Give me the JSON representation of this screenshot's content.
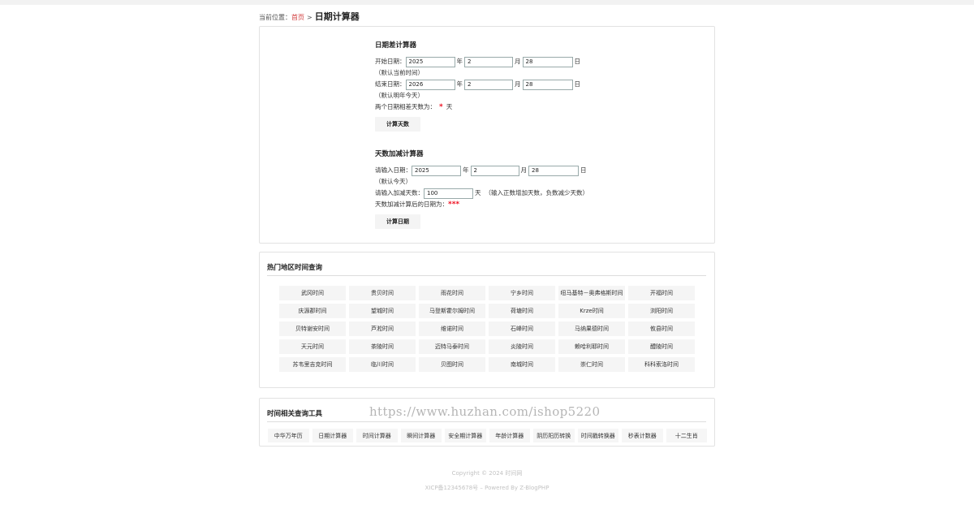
{
  "breadcrumb": {
    "prefix": "当前位置：",
    "home": "首页",
    "sep": ">",
    "current": "日期计算器"
  },
  "diff_calc": {
    "title": "日期差计算器",
    "start_label": "开始日期：",
    "start_year": "2025",
    "start_month": "2",
    "start_day": "28",
    "start_note": "（默认当前时间）",
    "end_label": "结束日期：",
    "end_year": "2026",
    "end_month": "2",
    "end_day": "28",
    "end_note": "（默认明年今天）",
    "result_label": "两个日期相差天数为：",
    "result_value": "*",
    "result_unit": "天",
    "button": "计算天数"
  },
  "add_calc": {
    "title": "天数加减计算器",
    "date_label": "请输入日期：",
    "year": "2025",
    "month": "2",
    "day": "28",
    "date_note": "（默认今天）",
    "days_label": "请输入加减天数：",
    "days_value": "100",
    "days_unit": "天",
    "days_note": "（输入正数增加天数，负数减少天数）",
    "result_label": "天数加减计算后的日期为：",
    "result_value": "***",
    "button": "计算日期"
  },
  "units": {
    "year": "年",
    "month": "月",
    "day": "日"
  },
  "regions": {
    "title": "热门地区时间查询",
    "items": [
      "武冈时间",
      "贵贝时间",
      "雨花时间",
      "宁乡时间",
      "纽马基特－奥弗格斯时间",
      "开福时间",
      "庆源郡时间",
      "望城时间",
      "马登斯霍尔姆时间",
      "荷塘时间",
      "Krze时间",
      "浏阳时间",
      "贝特谢安时间",
      "芦淞时间",
      "维诺时间",
      "石峰时间",
      "马纳果德时间",
      "攸县时间",
      "天元时间",
      "茶陵时间",
      "迈特马泰时间",
      "炎陵时间",
      "赖哈利耶时间",
      "醴陵时间",
      "苏韦里吉克时间",
      "临川时间",
      "贝图时间",
      "南城时间",
      "崇仁时间",
      "科科索洛时间"
    ]
  },
  "tools": {
    "title": "时间相关查询工具",
    "items": [
      "中华万年历",
      "日期计算器",
      "时间计算器",
      "瞬间计算器",
      "安全期计算器",
      "年龄计算器",
      "阴历阳历转换",
      "时间戳转换器",
      "秒表计数器",
      "十二生肖"
    ]
  },
  "watermark": "https://www.huzhan.com/ishop5220",
  "footer": {
    "copyright": "Copyright © 2024 时间网",
    "icp": "XICP备12345678号 – Powered By Z-BlogPHP"
  }
}
